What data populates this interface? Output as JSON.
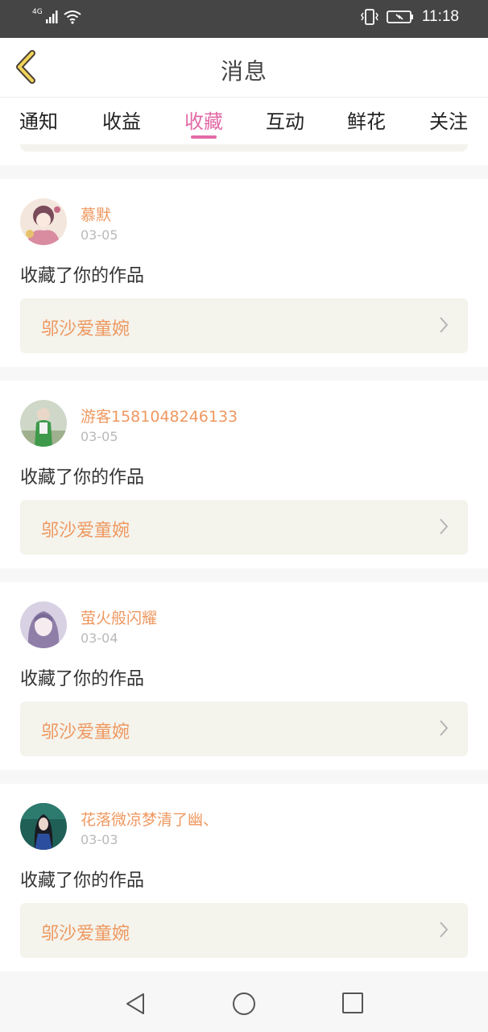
{
  "status_bar": {
    "network": "4G",
    "time": "11:18"
  },
  "header": {
    "title": "消息",
    "back_icon": "chevron-left-icon"
  },
  "tabs": [
    {
      "label": "通知",
      "active": false
    },
    {
      "label": "收益",
      "active": false
    },
    {
      "label": "收藏",
      "active": true
    },
    {
      "label": "互动",
      "active": false
    },
    {
      "label": "鲜花",
      "active": false
    },
    {
      "label": "关注",
      "active": false
    }
  ],
  "colors": {
    "accent": "#e36aa6",
    "name_orange": "#ee9860",
    "card_bg": "#f4f3ec"
  },
  "messages": [
    {
      "user": "慕默",
      "date": "03-05",
      "action": "收藏了你的作品",
      "work_title": "邬沙爱童婉"
    },
    {
      "user": "游客1581048246133",
      "date": "03-05",
      "action": "收藏了你的作品",
      "work_title": "邬沙爱童婉"
    },
    {
      "user": "萤火般闪耀",
      "date": "03-04",
      "action": "收藏了你的作品",
      "work_title": "邬沙爱童婉"
    },
    {
      "user": "花落微凉梦清了幽、",
      "date": "03-03",
      "action": "收藏了你的作品",
      "work_title": "邬沙爱童婉"
    }
  ],
  "nav_bar": [
    "back-triangle-icon",
    "home-circle-icon",
    "recents-square-icon"
  ]
}
